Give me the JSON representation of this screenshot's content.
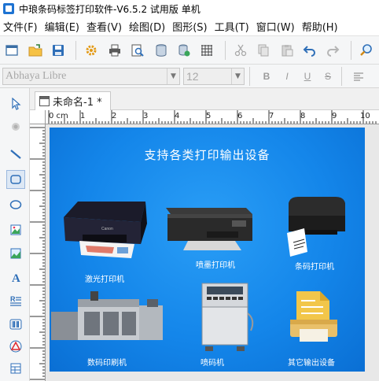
{
  "window": {
    "title": "中琅条码标签打印软件-V6.5.2 试用版 单机"
  },
  "menu": [
    {
      "label": "文件(F)"
    },
    {
      "label": "编辑(E)"
    },
    {
      "label": "查看(V)"
    },
    {
      "label": "绘图(D)"
    },
    {
      "label": "图形(S)"
    },
    {
      "label": "工具(T)"
    },
    {
      "label": "窗口(W)"
    },
    {
      "label": "帮助(H)"
    }
  ],
  "toolbar": {
    "buttons": [
      "new-icon",
      "open-icon",
      "save-icon",
      "settings-icon",
      "print-icon",
      "print-preview-icon",
      "database-icon",
      "database-settings-icon",
      "grid-icon",
      "cut-icon",
      "copy-icon",
      "paste-icon",
      "undo-icon",
      "redo-icon",
      "zoom-icon"
    ]
  },
  "font_toolbar": {
    "font_name": "Abhaya Libre",
    "font_size": "12",
    "bold": "B",
    "italic": "I",
    "underline": "U",
    "strikethrough": "S"
  },
  "document": {
    "tab_title": "未命名-1 *"
  },
  "ruler": {
    "unit_label": "0 cm",
    "marks": [
      "1",
      "2",
      "3",
      "4",
      "5",
      "6",
      "7",
      "8",
      "9",
      "10"
    ]
  },
  "label": {
    "title": "支持各类打印输出设备",
    "devices": [
      {
        "caption": "激光打印机"
      },
      {
        "caption": "喷墨打印机"
      },
      {
        "caption": "条码打印机"
      },
      {
        "caption": "数码印刷机"
      },
      {
        "caption": "喷码机"
      },
      {
        "caption": "其它输出设备"
      }
    ]
  },
  "colors": {
    "canvas_blue": "#1486ea",
    "accent": "#1e73d2"
  }
}
